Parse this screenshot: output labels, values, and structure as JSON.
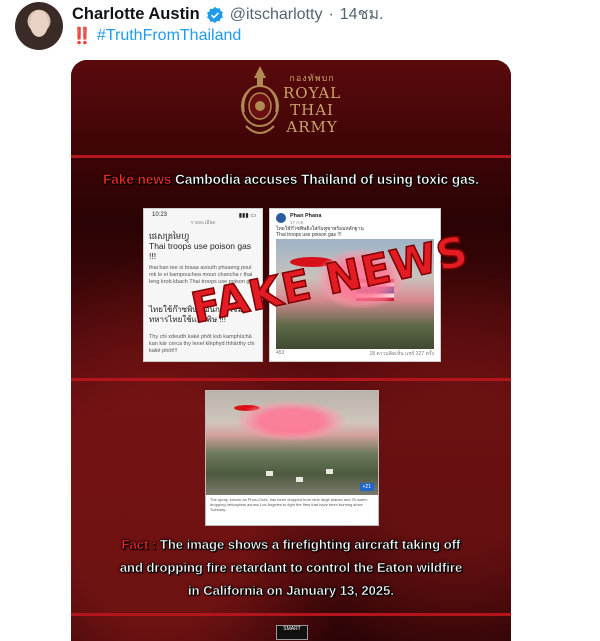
{
  "tweet": {
    "author_name": "Charlotte Austin",
    "handle": "@itscharlotty",
    "separator": "·",
    "time": "14ชม.",
    "alert": "‼️",
    "hashtag": "#TruthFromThailand",
    "verified_icon": "verified-badge-icon",
    "accent": "#1d9bf0"
  },
  "poster": {
    "org_thai": "กองทัพบก",
    "org_line1": "ROYAL",
    "org_line2": "THAI",
    "org_line3": "ARMY",
    "headline_red": "Fake news",
    "headline_rest": " Cambodia accuses Thailand of using toxic gas.",
    "stamp": "FAKE NEWS",
    "fact_label": "Fact :",
    "fact_line1": " The image shows a firefighting aircraft taking off",
    "fact_line2": "and dropping fire retardant to control the Eaton wildfire",
    "fact_line3": "in California on January 13, 2025.",
    "logo_text": "SMART",
    "brand_red": "#b4141c"
  },
  "screenshot1": {
    "time": "10:23",
    "title": "รายละเอียด",
    "khmer": "ផេសគ្រមៃហ្វូ",
    "english": "Thai troops use poison gas !!!",
    "romanized": "thai ban tee si braaa avouth phsaeng poul mk le ei kampouchea moun chancha r thai leng krob kbach Thai troops use poison gas",
    "thai_big": "ไทยใช้ก๊าซพิษ ก่อนการโจมตี ทหารไทยใช้แก๊สพิษ !!!",
    "thai_rom": "Thy chi xdeudh kaké phôt ksb kamphûchä kan kär cerca thy lenel klèphyd thhärthy chi kaké phöt!!!"
  },
  "screenshot2": {
    "page_name": "Phan Phana",
    "sub": "17 ก.ค.",
    "text": "ไทยใช้ก๊าซพิษยิงใส่กัมพูชาพร้อมหลักฐาน",
    "text2": "Thai troops use poison gas !!!",
    "footer_left": "453",
    "footer_right": "18 ความคิดเห็น  แชร์ 327 ครั้ง"
  },
  "photo3": {
    "caption": "The spray, known as Phos-Chek, has been dropped from nine large planes and 20 water-dropping helicopters across Los Angeles to fight the fires that have been burning since Tuesday.",
    "badge": "+21"
  }
}
